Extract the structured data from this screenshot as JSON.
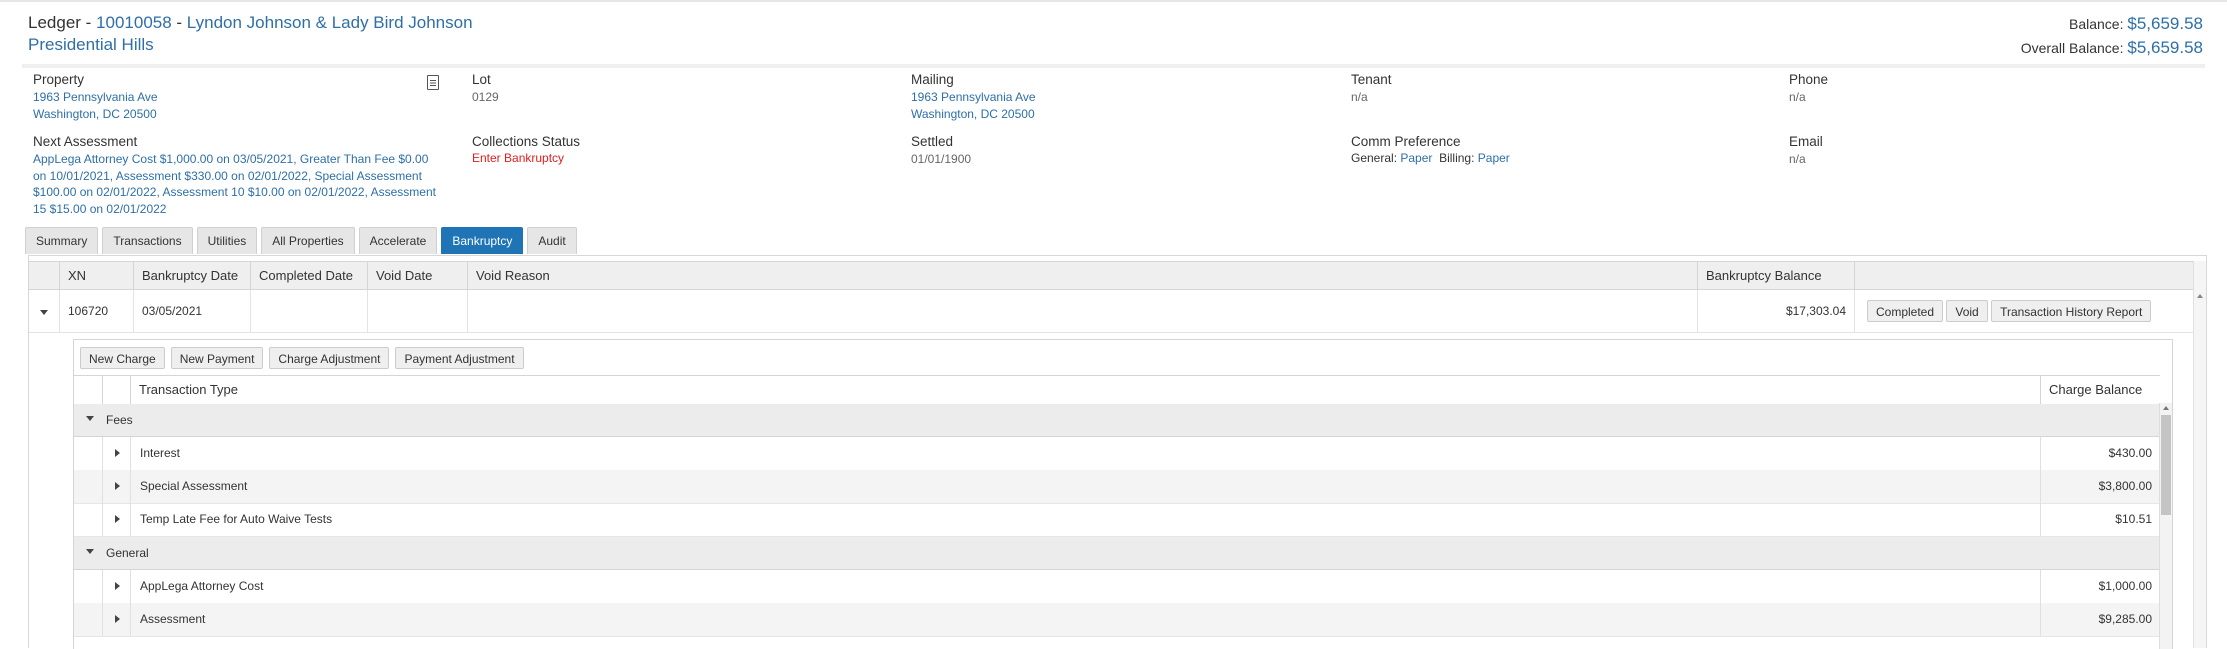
{
  "header": {
    "prefix": "Ledger - ",
    "account": "10010058",
    "separator": " - ",
    "owner": "Lyndon Johnson & Lady Bird Johnson",
    "community": "Presidential Hills",
    "balance_label": "Balance:",
    "balance": "$5,659.58",
    "overall_label": "Overall Balance:",
    "overall": "$5,659.58"
  },
  "info": {
    "property": {
      "label": "Property",
      "line1": "1963 Pennsylvania Ave",
      "line2": "Washington, DC 20500"
    },
    "lot": {
      "label": "Lot",
      "value": "0129"
    },
    "mailing": {
      "label": "Mailing",
      "line1": "1963 Pennsylvania Ave",
      "line2": "Washington, DC 20500"
    },
    "tenant": {
      "label": "Tenant",
      "value": "n/a"
    },
    "phone": {
      "label": "Phone",
      "value": "n/a"
    },
    "next_assessment": {
      "label": "Next Assessment",
      "lines": [
        "AppLega Attorney Cost $1,000.00 on 03/05/2021, Greater Than Fee $0.00",
        "on 10/01/2021, Assessment $330.00 on 02/01/2022, Special Assessment",
        "$100.00 on 02/01/2022, Assessment 10 $10.00 on 02/01/2022, Assessment",
        "15 $15.00 on 02/01/2022"
      ]
    },
    "collections": {
      "label": "Collections Status",
      "value": "Enter Bankruptcy"
    },
    "settled": {
      "label": "Settled",
      "value": "01/01/1900"
    },
    "comm": {
      "label": "Comm Preference",
      "general_label": "General:",
      "general": "Paper",
      "billing_label": "Billing:",
      "billing": "Paper"
    },
    "email": {
      "label": "Email",
      "value": "n/a"
    }
  },
  "tabs": [
    "Summary",
    "Transactions",
    "Utilities",
    "All Properties",
    "Accelerate",
    "Bankruptcy",
    "Audit"
  ],
  "active_tab": "Bankruptcy",
  "grid": {
    "columns": [
      "XN",
      "Bankruptcy Date",
      "Completed Date",
      "Void Date",
      "Void Reason",
      "Bankruptcy Balance"
    ],
    "row": {
      "xn": "106720",
      "bankruptcy_date": "03/05/2021",
      "completed_date": "",
      "void_date": "",
      "void_reason": "",
      "balance": "$17,303.04",
      "actions": [
        "Completed",
        "Void",
        "Transaction History Report"
      ]
    }
  },
  "detail": {
    "actions": [
      "New Charge",
      "New Payment",
      "Charge Adjustment",
      "Payment Adjustment"
    ],
    "columns": [
      "Transaction Type",
      "Charge Balance"
    ],
    "groups": [
      {
        "name": "Fees",
        "rows": [
          {
            "type": "Interest",
            "balance": "$430.00"
          },
          {
            "type": "Special Assessment",
            "balance": "$3,800.00"
          },
          {
            "type": "Temp Late Fee for Auto Waive Tests",
            "balance": "$10.51"
          }
        ]
      },
      {
        "name": "General",
        "rows": [
          {
            "type": "AppLega Attorney Cost",
            "balance": "$1,000.00"
          },
          {
            "type": "Assessment",
            "balance": "$9,285.00"
          }
        ]
      }
    ]
  }
}
